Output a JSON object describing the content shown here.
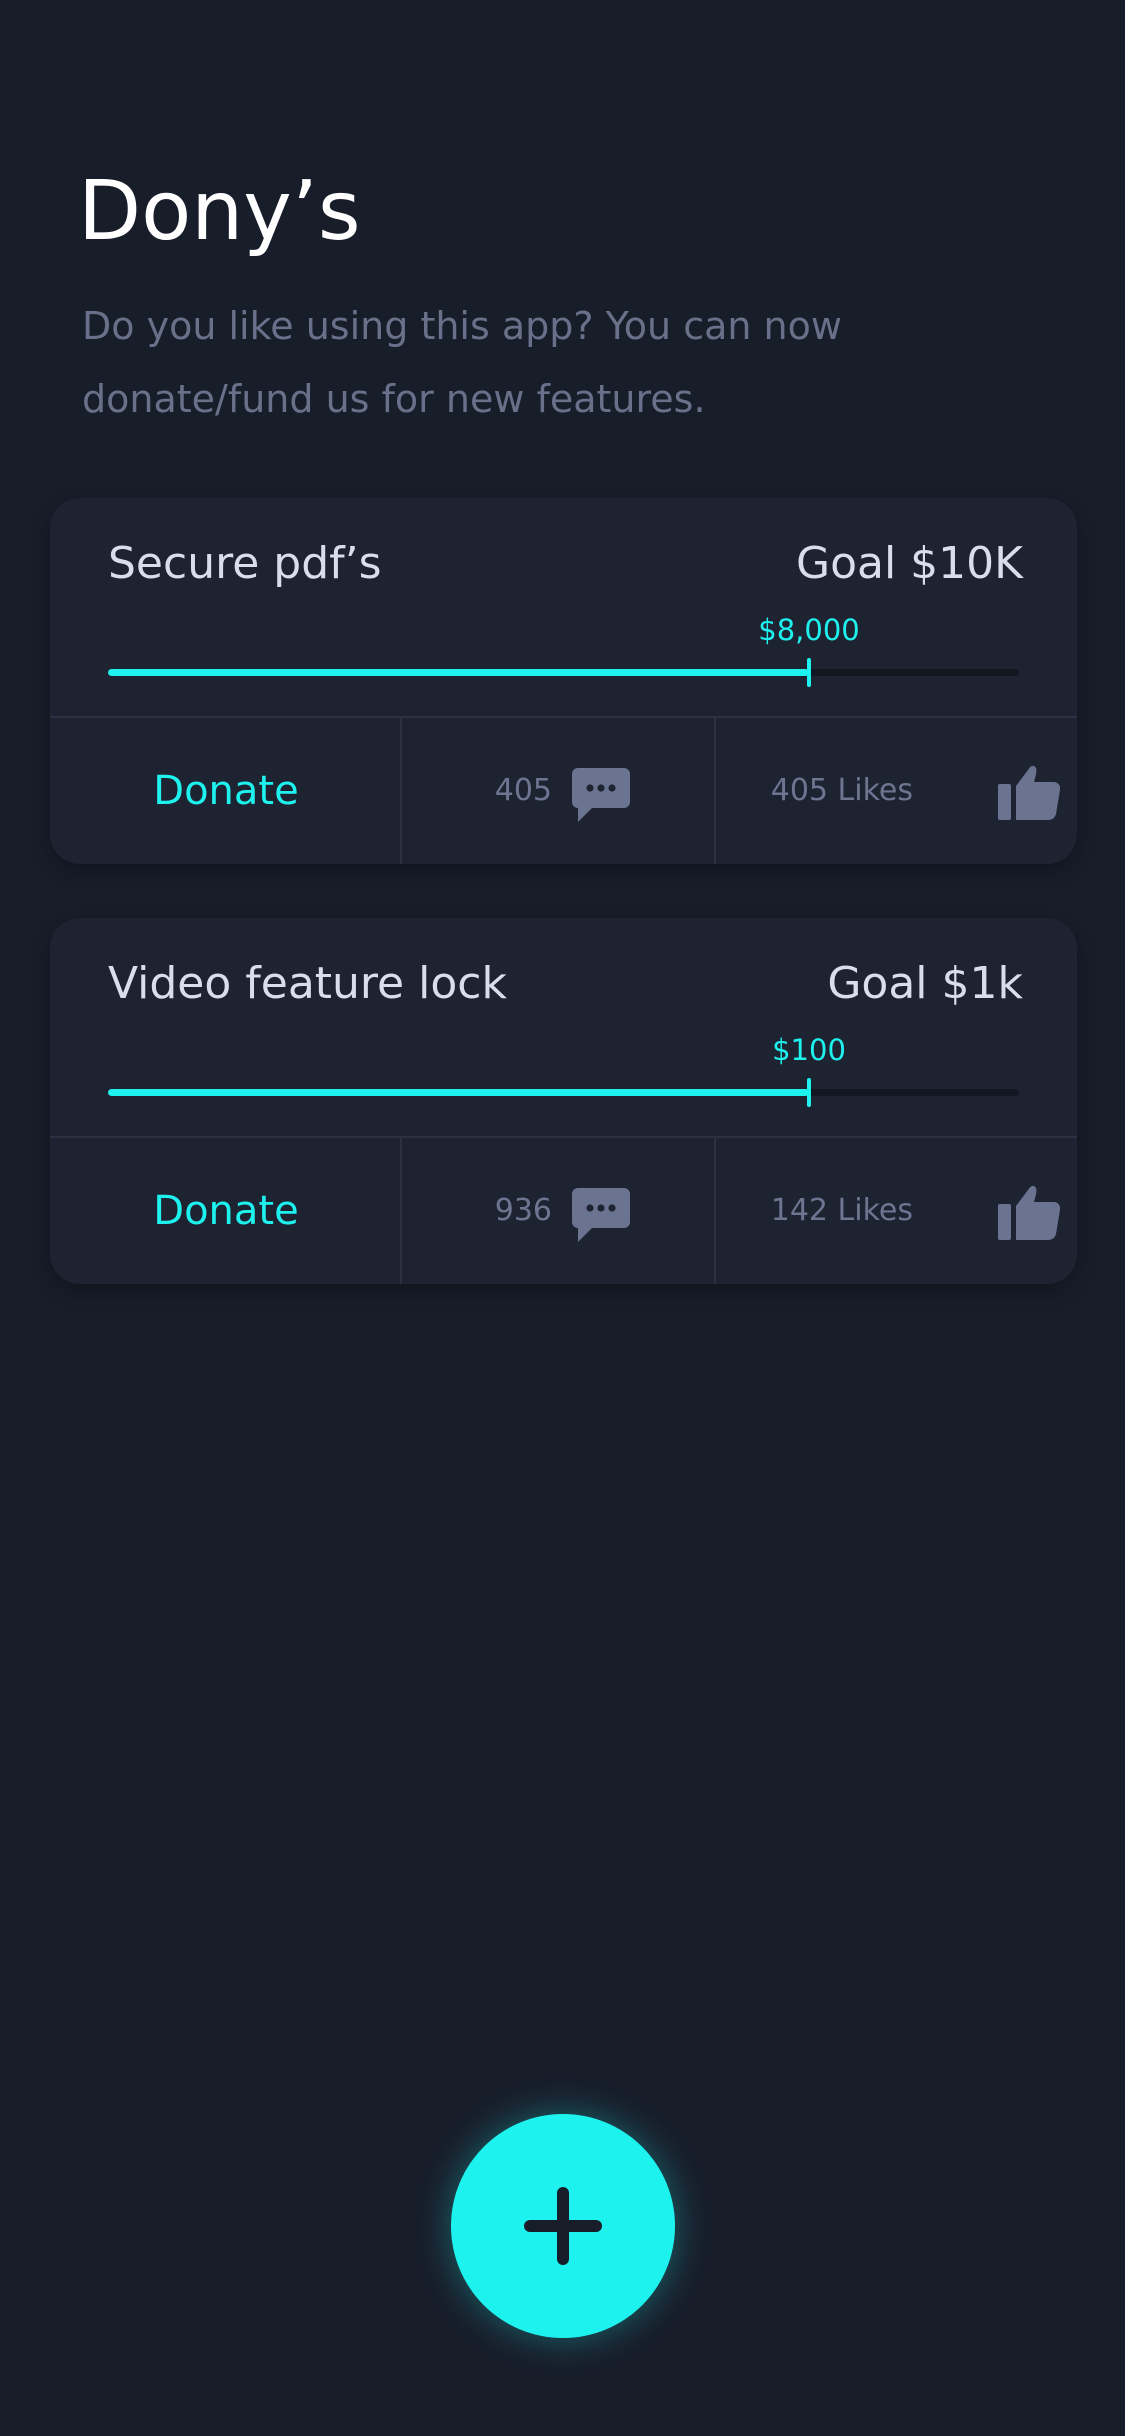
{
  "header": {
    "title": "Dony’s",
    "subtitle": "Do you like using this app? You can now donate/fund us for new features."
  },
  "colors": {
    "background": "#181d2a",
    "card": "#1e2332",
    "accent": "#1df2ee",
    "muted_text": "#6a7089",
    "card_text": "#d9deee"
  },
  "cards": [
    {
      "name": "Secure pdf’s",
      "goal": "Goal $10K",
      "raised": "$8,000",
      "progress_fraction": 0.77,
      "donate_label": "Donate",
      "comments": "405",
      "likes": "405 Likes"
    },
    {
      "name": "Video feature lock",
      "goal": "Goal $1k",
      "raised": "$100",
      "progress_fraction": 0.77,
      "donate_label": "Donate",
      "comments": "936",
      "likes": "142 Likes"
    }
  ],
  "icons": {
    "comment": "comment-icon",
    "like": "thumbs-up-icon",
    "add": "plus-icon"
  }
}
